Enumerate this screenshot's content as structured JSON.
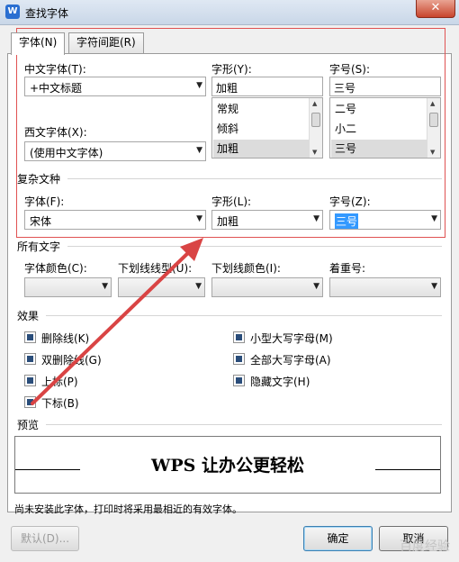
{
  "window": {
    "title": "查找字体",
    "app_icon_letter": "W",
    "close_glyph": "✕"
  },
  "tabs": [
    {
      "label": "字体(N)"
    },
    {
      "label": "字符间距(R)"
    }
  ],
  "chinese_font": {
    "label": "中文字体(T):",
    "value": "+中文标题"
  },
  "western_font": {
    "label": "西文字体(X):",
    "value": "(使用中文字体)"
  },
  "style": {
    "label": "字形(Y):",
    "value": "加粗",
    "options": [
      "常规",
      "倾斜",
      "加粗"
    ]
  },
  "size": {
    "label": "字号(S):",
    "value": "三号",
    "options": [
      "二号",
      "小二",
      "三号"
    ]
  },
  "complex": {
    "section": "复杂文种",
    "font_label": "字体(F):",
    "font_value": "宋体",
    "style_label": "字形(L):",
    "style_value": "加粗",
    "size_label": "字号(Z):",
    "size_value": "三号"
  },
  "all_text": {
    "section": "所有文字",
    "font_color_label": "字体颜色(C):",
    "underline_style_label": "下划线线型(U):",
    "underline_color_label": "下划线颜色(I):",
    "emphasis_label": "着重号:"
  },
  "effects": {
    "section": "效果",
    "items": [
      "删除线(K)",
      "双删除线(G)",
      "上标(P)",
      "下标(B)",
      "小型大写字母(M)",
      "全部大写字母(A)",
      "隐藏文字(H)"
    ]
  },
  "preview": {
    "section": "预览",
    "text": "WPS 让办公更轻松"
  },
  "note": "尚未安装此字体，打印时将采用最相近的有效字体。",
  "buttons": {
    "default": "默认(D)...",
    "ok": "确定",
    "cancel": "取消"
  },
  "watermark": "百度经验",
  "colors": {
    "highlight": "#e05252",
    "arrow": "#d94444",
    "selection": "#3399ff"
  }
}
